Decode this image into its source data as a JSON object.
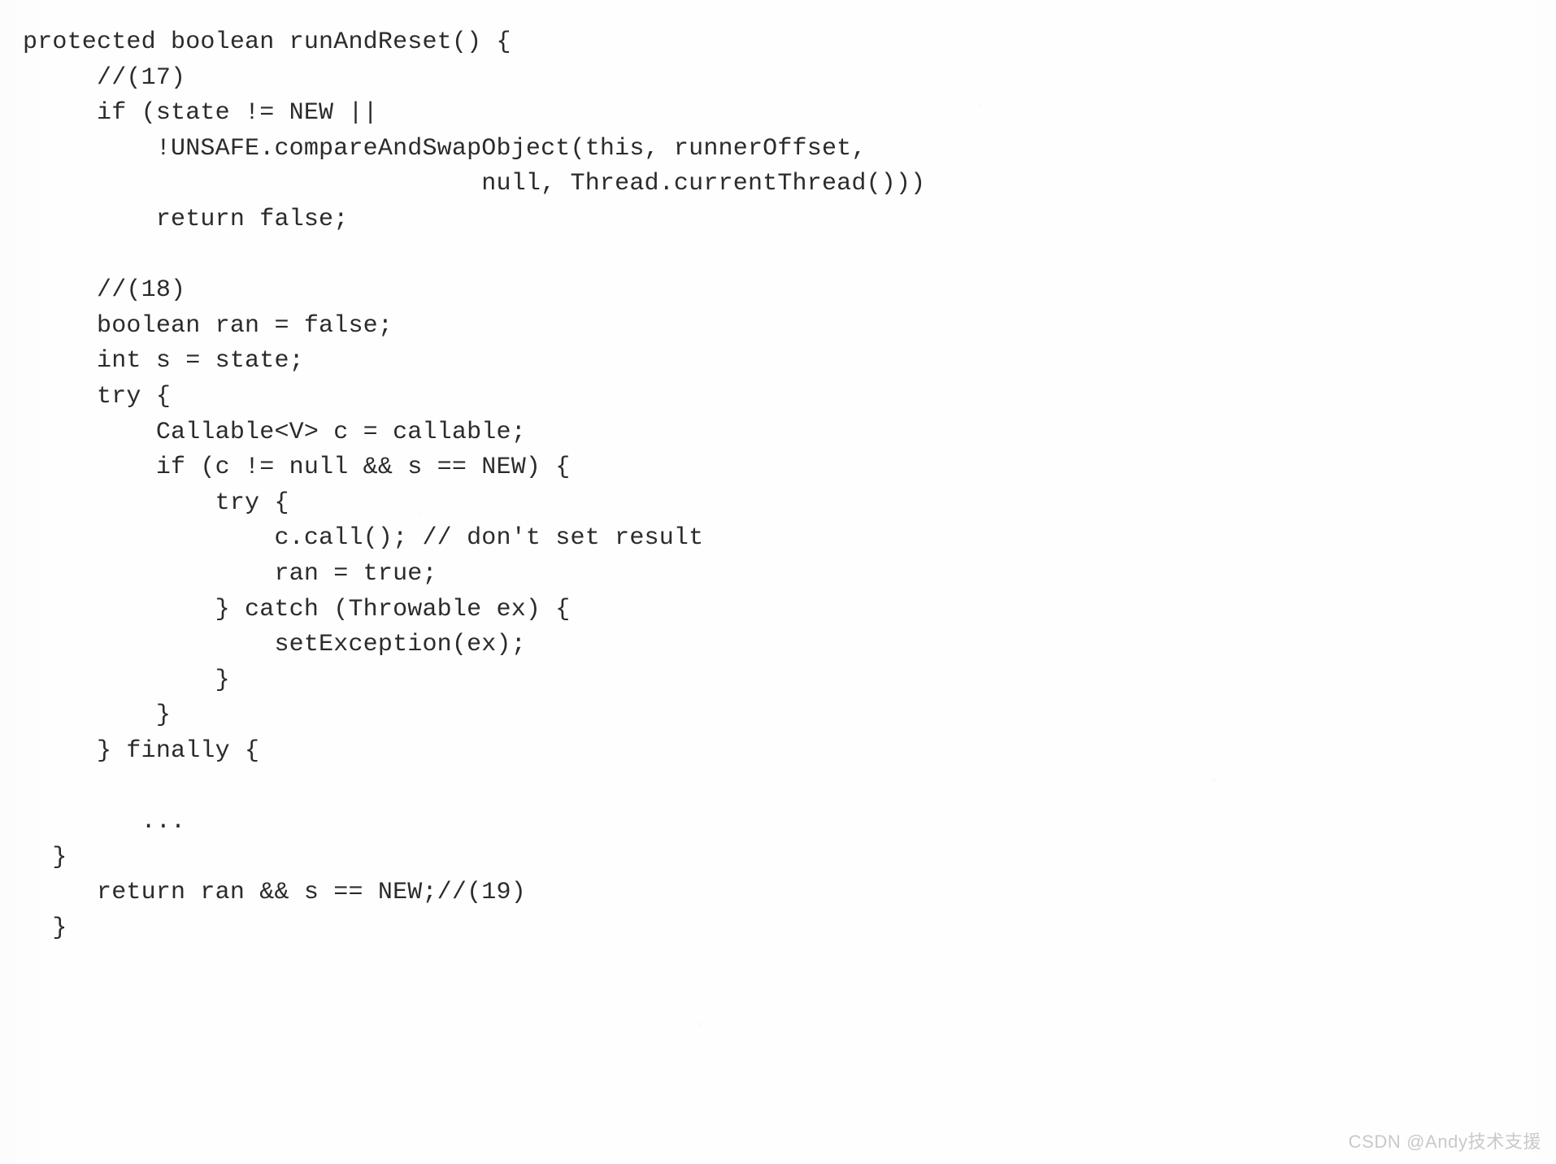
{
  "document": {
    "kind": "scanned-code-listing",
    "language": "Java",
    "background_color": "#fefefe",
    "text_color": "#2b2b2b"
  },
  "code": {
    "lines": [
      "protected boolean runAndReset() {",
      "     //(17)",
      "     if (state != NEW ||",
      "         !UNSAFE.compareAndSwapObject(this, runnerOffset,",
      "                               null, Thread.currentThread()))",
      "         return false;",
      "",
      "     //(18)",
      "     boolean ran = false;",
      "     int s = state;",
      "     try {",
      "         Callable<V> c = callable;",
      "         if (c != null && s == NEW) {",
      "             try {",
      "                 c.call(); // don't set result",
      "                 ran = true;",
      "             } catch (Throwable ex) {",
      "                 setException(ex);",
      "             }",
      "         }",
      "     } finally {",
      "",
      "        ...",
      "  }",
      "     return ran && s == NEW;//(19)",
      "  }"
    ]
  },
  "watermark": {
    "text": "CSDN @Andy技术支援",
    "color": "#c9c9c9"
  }
}
